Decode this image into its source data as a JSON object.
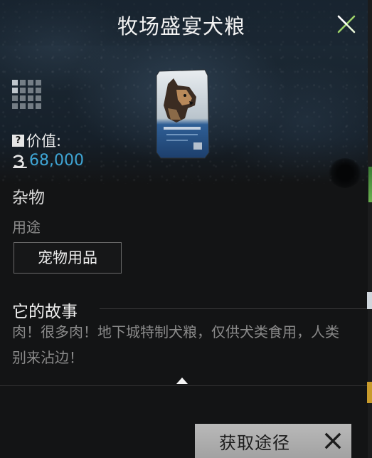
{
  "header": {
    "title": "牧场盛宴犬粮",
    "close_icon": "close-x-icon"
  },
  "item": {
    "grade_icon": "grade-grid-icon",
    "image_icon": "dog-food-bag-image",
    "value_label": "价值:",
    "value_help_icon": "question-mark-icon",
    "currency_icon": "coin-currency-icon",
    "value": "68,000",
    "category": "杂物",
    "usage_label": "用途",
    "usage_tag": "宠物用品"
  },
  "story": {
    "title": "它的故事",
    "text": "肉！很多肉！地下城特制犬粮，仅供犬类食用，人类别来沾边！"
  },
  "footer": {
    "acquire_label": "获取途径",
    "acquire_close_icon": "close-x-icon"
  },
  "colors": {
    "value_blue": "#3fa6d6",
    "button_gray": "#b0b0b0",
    "close_green": "#9ed36a"
  }
}
